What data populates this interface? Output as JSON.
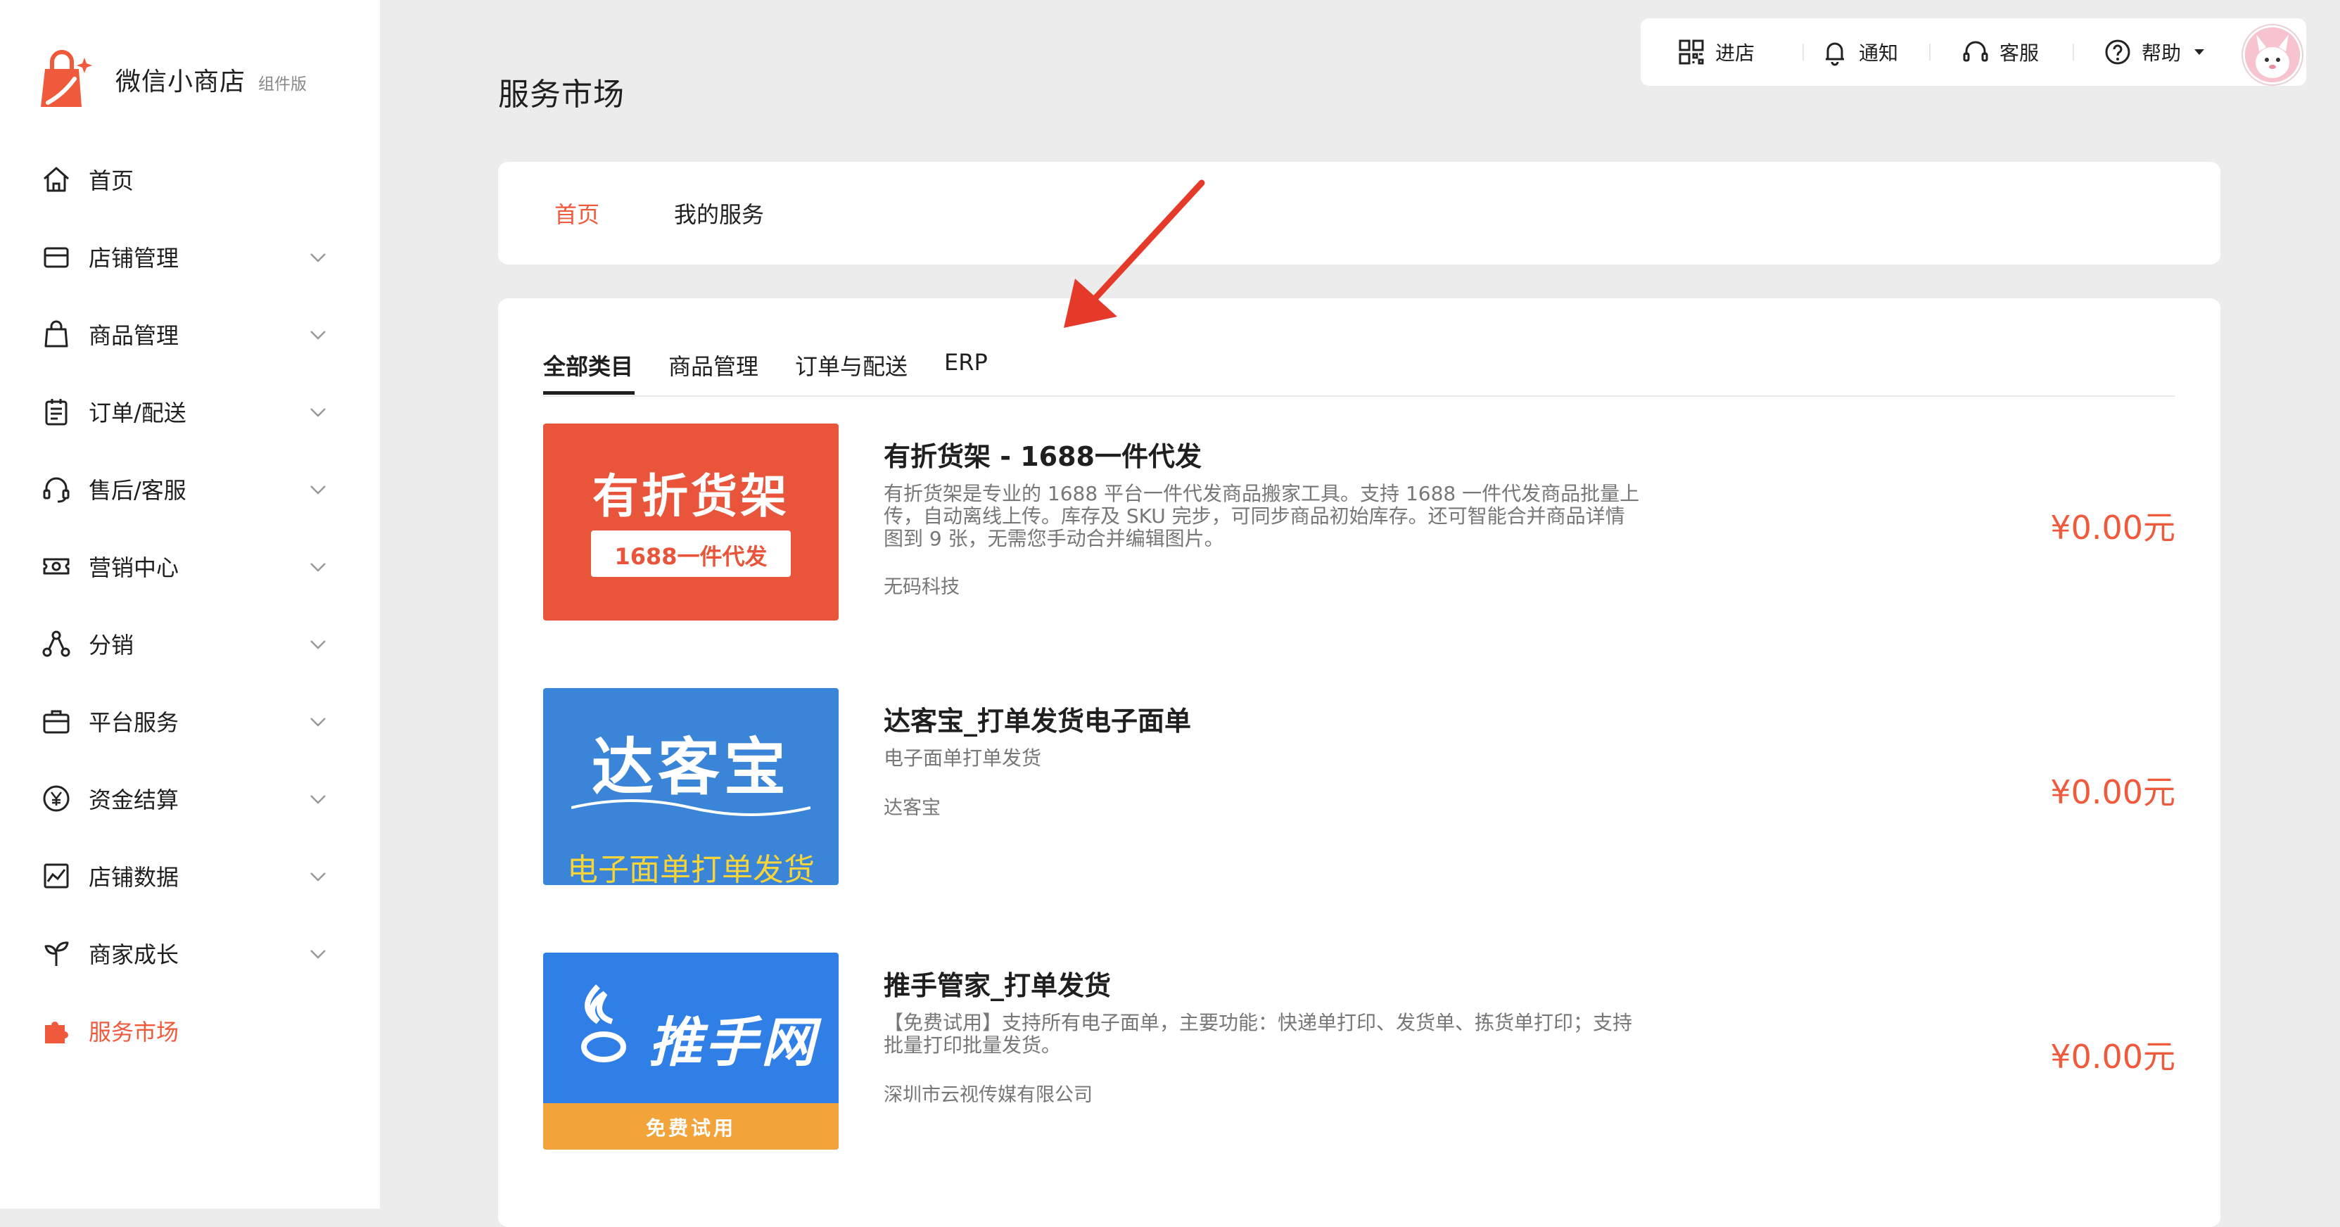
{
  "app": {
    "name": "微信小商店",
    "version_badge": "组件版"
  },
  "sidebar": {
    "items": [
      {
        "label": "首页",
        "icon": "home-icon",
        "expandable": false
      },
      {
        "label": "店铺管理",
        "icon": "store-icon",
        "expandable": true
      },
      {
        "label": "商品管理",
        "icon": "bag-icon",
        "expandable": true
      },
      {
        "label": "订单/配送",
        "icon": "order-icon",
        "expandable": true
      },
      {
        "label": "售后/客服",
        "icon": "headset-icon",
        "expandable": true
      },
      {
        "label": "营销中心",
        "icon": "coupon-icon",
        "expandable": true
      },
      {
        "label": "分销",
        "icon": "share-icon",
        "expandable": true
      },
      {
        "label": "平台服务",
        "icon": "briefcase-icon",
        "expandable": true
      },
      {
        "label": "资金结算",
        "icon": "yen-icon",
        "expandable": true
      },
      {
        "label": "店铺数据",
        "icon": "chart-icon",
        "expandable": true
      },
      {
        "label": "商家成长",
        "icon": "sprout-icon",
        "expandable": true
      },
      {
        "label": "服务市场",
        "icon": "puzzle-icon",
        "expandable": false,
        "active": true
      }
    ]
  },
  "topbar": {
    "enter_store": "进店",
    "notify": "通知",
    "service": "客服",
    "help": "帮助"
  },
  "page": {
    "title": "服务市场",
    "tabs": [
      {
        "label": "首页",
        "active": true
      },
      {
        "label": "我的服务",
        "active": false
      }
    ],
    "categories": [
      {
        "label": "全部类目",
        "active": true
      },
      {
        "label": "商品管理",
        "active": false
      },
      {
        "label": "订单与配送",
        "active": false
      },
      {
        "label": "ERP",
        "active": false
      }
    ]
  },
  "services": [
    {
      "name": "有折货架 - 1688一件代发",
      "description": "有折货架是专业的 1688 平台一件代发商品搬家工具。支持 1688 一件代发商品批量上传，自动离线上传。库存及 SKU 完步，可同步商品初始库存。还可智能合并商品详情图到 9 张，无需您手动合并编辑图片。",
      "vendor": "无码科技",
      "price": "¥0.00元",
      "banner": {
        "title": "有折货架",
        "tag": "1688一件代发",
        "bg": "#e8553a"
      }
    },
    {
      "name": "达客宝_打单发货电子面单",
      "description": "电子面单打单发货",
      "vendor": "达客宝",
      "price": "¥0.00元",
      "banner": {
        "title": "达客宝",
        "tag": "电子面单打单发货",
        "bg": "#3a85d8"
      }
    },
    {
      "name": "推手管家_打单发货",
      "description": "【免费试用】支持所有电子面单，主要功能：快递单打印、发货单、拣货单打印；支持批量打印批量发货。",
      "vendor": "深圳市云视传媒有限公司",
      "price": "¥0.00元",
      "banner": {
        "title": "推手网",
        "tag": "免费试用",
        "bg": "#2f7fe6"
      }
    }
  ],
  "colors": {
    "accent": "#f05a3c",
    "background": "#ececec",
    "card": "#ffffff"
  }
}
